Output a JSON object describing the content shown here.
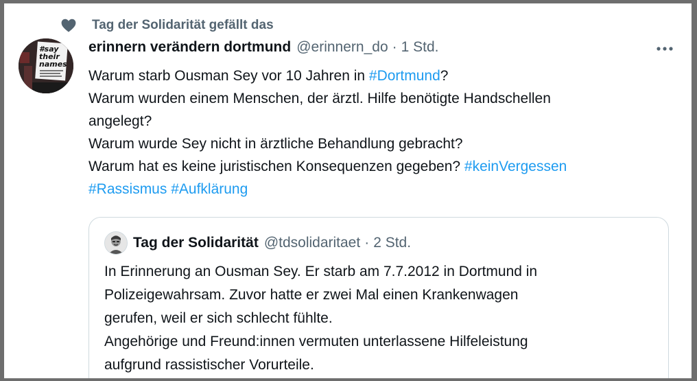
{
  "social_context": {
    "icon": "heart-icon",
    "text": "Tag der Solidarität gefällt das"
  },
  "tweet": {
    "avatar": {
      "text_lines": [
        "#say",
        "their",
        "names"
      ]
    },
    "author_name": "erinnern verändern dortmund",
    "author_handle": "@erinnern_do",
    "separator": "·",
    "timestamp": "1 Std.",
    "more_icon": "more-horizontal-icon",
    "lines": [
      {
        "pre": "Warum starb Ousman Sey vor 10 Jahren in ",
        "tag": "#Dortmund",
        "post": "?"
      },
      {
        "pre": "Warum wurden einem Menschen, der ärztl. Hilfe benötigte Handschellen",
        "tag": "",
        "post": ""
      },
      {
        "pre": "angelegt?",
        "tag": "",
        "post": ""
      },
      {
        "pre": "Warum wurde Sey nicht in ärztliche Behandlung gebracht?",
        "tag": "",
        "post": ""
      },
      {
        "pre": "Warum hat es keine juristischen Konsequenzen gegeben? ",
        "tag": "#keinVergessen",
        "post": ""
      }
    ],
    "hashtag_line": [
      "#Rassismus",
      "#Aufklärung"
    ]
  },
  "quote": {
    "author_name": "Tag der Solidarität",
    "author_handle": "@tdsolidaritaet",
    "separator": "·",
    "timestamp": "2 Std.",
    "lines": [
      "In Erinnerung an Ousman Sey. Er starb am 7.7.2012 in Dortmund in",
      "Polizeigewahrsam. Zuvor hatte er zwei Mal einen Krankenwagen",
      "gerufen, weil er sich schlecht fühlte.",
      "Angehörige und Freund:innen vermuten unterlassene Hilfeleistung",
      "aufgrund rassistischer Vorurteile."
    ]
  },
  "colors": {
    "link": "#1d9bf0",
    "secondary_text": "#536471",
    "primary_text": "#0f1419",
    "border": "#cfd9de"
  }
}
